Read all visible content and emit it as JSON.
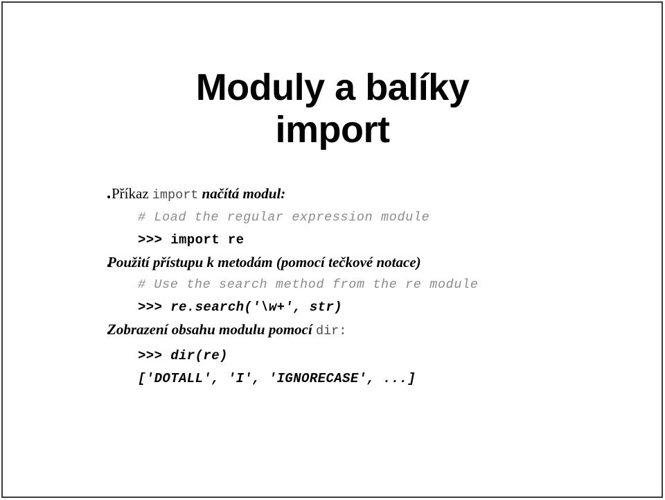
{
  "slide": {
    "border_color": "#3a3a3a",
    "background": "#ffffff",
    "title": {
      "line1": "Moduly a balíky",
      "line2": "import"
    },
    "bullets": [
      {
        "lead": "Příkaz",
        "mono": "import",
        "tail": "načítá modul:"
      },
      {
        "lead": "Použití přístupu k metodám (pomocí tečkové notace)",
        "mono": "",
        "tail": ""
      },
      {
        "lead": "Zobrazení obsahu modulu pomocí",
        "mono": "dir:",
        "tail": ""
      }
    ],
    "code_blocks": [
      {
        "comment": "# Load the regular expression module",
        "prompt": ">>> import re"
      },
      {
        "comment": "# Use the search method from the re module",
        "prompt": ">>> re.search('\\w+', str)"
      },
      {
        "comment": "",
        "prompt": ">>> dir(re)",
        "output": "['DOTALL', 'I', 'IGNORECASE', ...]"
      }
    ],
    "colors": {
      "comment_gray": "#8c8c8c",
      "text_black": "#000000"
    }
  }
}
